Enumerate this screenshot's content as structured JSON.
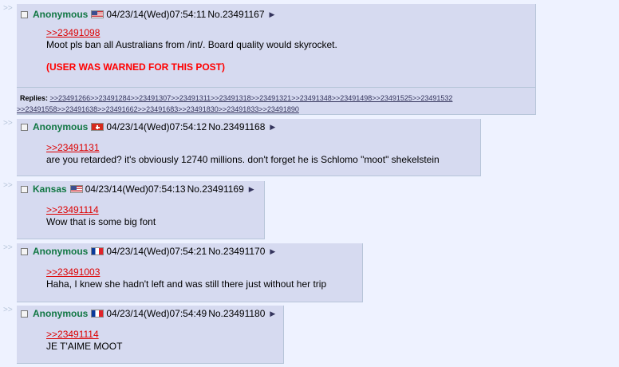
{
  "posts": [
    {
      "name": "Anonymous",
      "flag": "us-flag",
      "datetime": "04/23/14(Wed)07:54:11",
      "number": "No.23491167",
      "quote": ">>23491098",
      "text": "Moot pls ban all Australians from /int/. Board quality would skyrocket.",
      "warning": "(USER WAS WARNED FOR THIS POST)",
      "replies_label": "Replies:",
      "replies_line1": ">>23491266>>23491284>>23491307>>23491311>>23491318>>23491321>>23491348>>23491498>>23491525>>23491532",
      "replies_line2": ">>23491558>>23491638>>23491662>>23491683>>23491830>>23491833>>23491890"
    },
    {
      "name": "Anonymous",
      "flag": "ch-flag",
      "datetime": "04/23/14(Wed)07:54:12",
      "number": "No.23491168",
      "quote": ">>23491131",
      "text": "are you retarded? it's obviously 12740 millions. don't forget he is Schlomo \"moot\" shekelstein"
    },
    {
      "name": "Kansas",
      "flag": "us-flag",
      "datetime": "04/23/14(Wed)07:54:13",
      "number": "No.23491169",
      "quote": ">>23491114",
      "text": "Wow that is some big font"
    },
    {
      "name": "Anonymous",
      "flag": "fr-flag",
      "datetime": "04/23/14(Wed)07:54:21",
      "number": "No.23491170",
      "quote": ">>23491003",
      "text": "Haha, I knew she hadn't left and was still there just without her trip"
    },
    {
      "name": "Anonymous",
      "flag": "fr-flag",
      "datetime": "04/23/14(Wed)07:54:49",
      "number": "No.23491180",
      "quote": ">>23491114",
      "text": "JE T'AIME MOOT"
    }
  ],
  "ui": {
    "side_arrows": ">>",
    "expand_icon": "▶"
  },
  "colors": {
    "name": "#117743",
    "quote": "#dd0000",
    "warning": "#ff0000",
    "post_bg": "#d6daf0",
    "page_bg": "#eef2ff"
  }
}
